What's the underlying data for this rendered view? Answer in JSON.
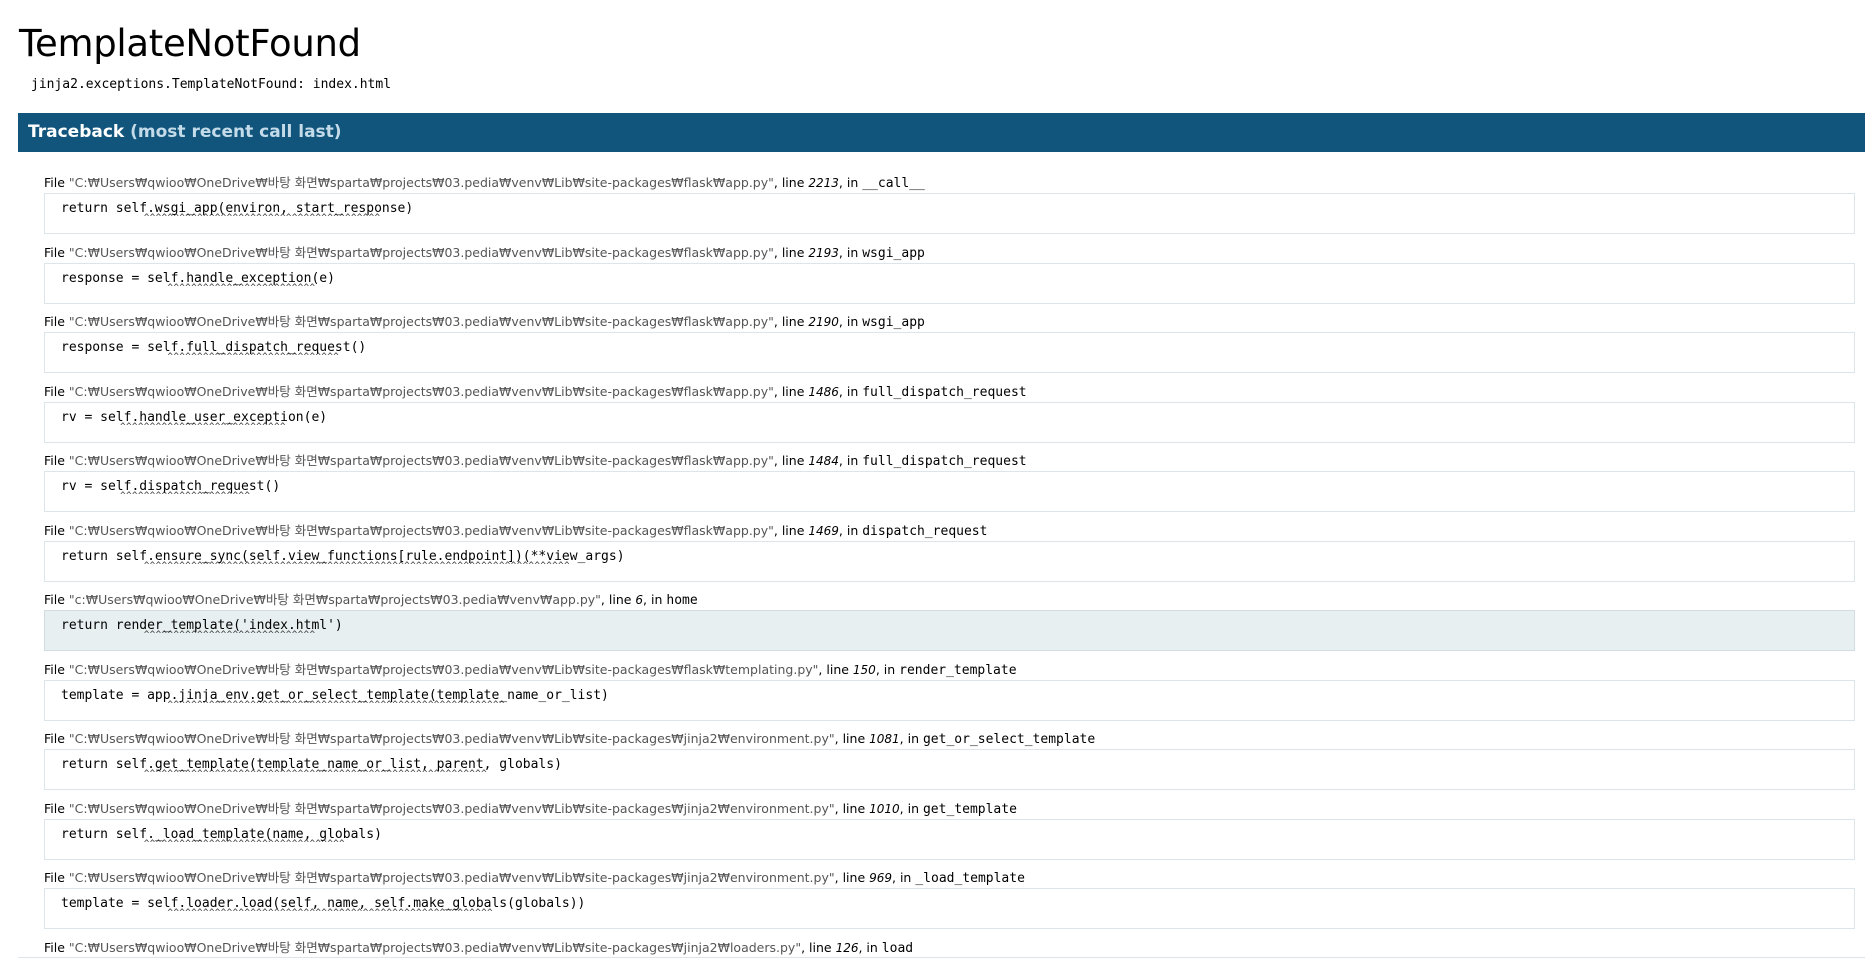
{
  "title": "TemplateNotFound",
  "error_message": "jinja2.exceptions.TemplateNotFound: index.html",
  "traceback_header": {
    "label": "Traceback",
    "sub": "(most recent call last)"
  },
  "frames": [
    {
      "file_prefix": "File ",
      "filename": "\"C:₩Users₩qwioo₩OneDrive₩바탕 화면₩sparta₩projects₩03.pedia₩venv₩Lib₩site-packages₩flask₩app.py\"",
      "line_label": ", line ",
      "lineno": "2213",
      "in_label": ", in ",
      "function": "__call__",
      "source": "return self.wsgi_app(environ, start_response)",
      "carets": "              ^^^^^^^^^^^^^^^^^^^^^^^^^^^^^^^^^^^^^^^^",
      "current": false
    },
    {
      "file_prefix": "File ",
      "filename": "\"C:₩Users₩qwioo₩OneDrive₩바탕 화면₩sparta₩projects₩03.pedia₩venv₩Lib₩site-packages₩flask₩app.py\"",
      "line_label": ", line ",
      "lineno": "2193",
      "in_label": ", in ",
      "function": "wsgi_app",
      "source": "response = self.handle_exception(e)",
      "carets": "                  ^^^^^^^^^^^^^^^^^^^^^^^^^",
      "current": false
    },
    {
      "file_prefix": "File ",
      "filename": "\"C:₩Users₩qwioo₩OneDrive₩바탕 화면₩sparta₩projects₩03.pedia₩venv₩Lib₩site-packages₩flask₩app.py\"",
      "line_label": ", line ",
      "lineno": "2190",
      "in_label": ", in ",
      "function": "wsgi_app",
      "source": "response = self.full_dispatch_request()",
      "carets": "                  ^^^^^^^^^^^^^^^^^^^^^^^^^^^^^",
      "current": false
    },
    {
      "file_prefix": "File ",
      "filename": "\"C:₩Users₩qwioo₩OneDrive₩바탕 화면₩sparta₩projects₩03.pedia₩venv₩Lib₩site-packages₩flask₩app.py\"",
      "line_label": ", line ",
      "lineno": "1486",
      "in_label": ", in ",
      "function": "full_dispatch_request",
      "source": "rv = self.handle_user_exception(e)",
      "carets": "          ^^^^^^^^^^^^^^^^^^^^^^^^^^^^",
      "current": false
    },
    {
      "file_prefix": "File ",
      "filename": "\"C:₩Users₩qwioo₩OneDrive₩바탕 화면₩sparta₩projects₩03.pedia₩venv₩Lib₩site-packages₩flask₩app.py\"",
      "line_label": ", line ",
      "lineno": "1484",
      "in_label": ", in ",
      "function": "full_dispatch_request",
      "source": "rv = self.dispatch_request()",
      "carets": "          ^^^^^^^^^^^^^^^^^^^^^^",
      "current": false
    },
    {
      "file_prefix": "File ",
      "filename": "\"C:₩Users₩qwioo₩OneDrive₩바탕 화면₩sparta₩projects₩03.pedia₩venv₩Lib₩site-packages₩flask₩app.py\"",
      "line_label": ", line ",
      "lineno": "1469",
      "in_label": ", in ",
      "function": "dispatch_request",
      "source": "return self.ensure_sync(self.view_functions[rule.endpoint])(**view_args)",
      "carets": "              ^^^^^^^^^^^^^^^^^^^^^^^^^^^^^^^^^^^^^^^^^^^^^^^^^^^^^^^^^^^^^^^^^^^^^^^^",
      "current": false
    },
    {
      "file_prefix": "File ",
      "filename": "\"c:₩Users₩qwioo₩OneDrive₩바탕 화면₩sparta₩projects₩03.pedia₩venv₩app.py\"",
      "line_label": ", line ",
      "lineno": "6",
      "in_label": ", in ",
      "function": "home",
      "source": "return render_template('index.html')",
      "carets": "              ^^^^^^^^^^^^^^^^^^^^^^^^^^^^^",
      "current": true
    },
    {
      "file_prefix": "File ",
      "filename": "\"C:₩Users₩qwioo₩OneDrive₩바탕 화면₩sparta₩projects₩03.pedia₩venv₩Lib₩site-packages₩flask₩templating.py\"",
      "line_label": ", line ",
      "lineno": "150",
      "in_label": ", in ",
      "function": "render_template",
      "source": "template = app.jinja_env.get_or_select_template(template_name_or_list)",
      "carets": "                  ^^^^^^^^^^^^^^^^^^^^^^^^^^^^^^^^^^^^^^^^^^^^^^^^^^^^^^^^^",
      "current": false
    },
    {
      "file_prefix": "File ",
      "filename": "\"C:₩Users₩qwioo₩OneDrive₩바탕 화면₩sparta₩projects₩03.pedia₩venv₩Lib₩site-packages₩jinja2₩environment.py\"",
      "line_label": ", line ",
      "lineno": "1081",
      "in_label": ", in ",
      "function": "get_or_select_template",
      "source": "return self.get_template(template_name_or_list, parent, globals)",
      "carets": "              ^^^^^^^^^^^^^^^^^^^^^^^^^^^^^^^^^^^^^^^^^^^^^^^^^^^^^^^^^^",
      "current": false
    },
    {
      "file_prefix": "File ",
      "filename": "\"C:₩Users₩qwioo₩OneDrive₩바탕 화면₩sparta₩projects₩03.pedia₩venv₩Lib₩site-packages₩jinja2₩environment.py\"",
      "line_label": ", line ",
      "lineno": "1010",
      "in_label": ", in ",
      "function": "get_template",
      "source": "return self._load_template(name, globals)",
      "carets": "              ^^^^^^^^^^^^^^^^^^^^^^^^^^^^^^^^^^",
      "current": false
    },
    {
      "file_prefix": "File ",
      "filename": "\"C:₩Users₩qwioo₩OneDrive₩바탕 화면₩sparta₩projects₩03.pedia₩venv₩Lib₩site-packages₩jinja2₩environment.py\"",
      "line_label": ", line ",
      "lineno": "969",
      "in_label": ", in ",
      "function": "_load_template",
      "source": "template = self.loader.load(self, name, self.make_globals(globals))",
      "carets": "                  ^^^^^^^^^^^^^^^^^^^^^^^^^^^^^^^^^^^^^^^^^^^^^^^^^^^^^^^",
      "current": false
    },
    {
      "file_prefix": "File ",
      "filename": "\"C:₩Users₩qwioo₩OneDrive₩바탕 화면₩sparta₩projects₩03.pedia₩venv₩Lib₩site-packages₩jinja2₩loaders.py\"",
      "line_label": ", line ",
      "lineno": "126",
      "in_label": ", in ",
      "function": "load",
      "source": "",
      "carets": "",
      "current": false
    }
  ],
  "colors": {
    "header_bg": "#11557c",
    "header_sub": "#c4dbe9",
    "current_bg": "#e8eff0"
  }
}
